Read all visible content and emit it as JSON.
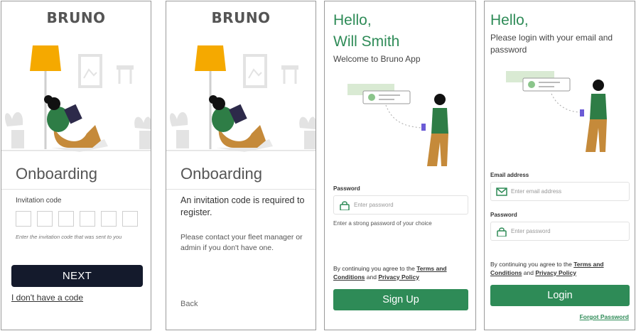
{
  "colors": {
    "brand_green": "#2e8b57",
    "dark_button": "#141a2c",
    "border": "#9a9a9a"
  },
  "screen1": {
    "brand": "BRUNO",
    "heading": "Onboarding",
    "invitation_label": "Invitation code",
    "code_boxes": 6,
    "hint": "Enter the invitation code that was sent to you",
    "next_button": "NEXT",
    "no_code_link": "I don't have a code"
  },
  "screen2": {
    "brand": "BRUNO",
    "heading": "Onboarding",
    "required_text": "An invitation code is required to register.",
    "contact_text": "Please contact your fleet manager or admin if you don't have one.",
    "back_link": "Back"
  },
  "screen3": {
    "hello": "Hello,",
    "name": "Will Smith",
    "welcome": "Welcome to Bruno App",
    "password_label": "Password",
    "password_placeholder": "Enter password",
    "password_help": "Enter a strong password of your choice",
    "terms_prefix": "By continuing you agree to the",
    "terms_link": "Terms and Conditions",
    "terms_and": "and",
    "privacy_link": "Privacy Policy",
    "signup_button": "Sign Up"
  },
  "screen4": {
    "hello": "Hello,",
    "subtitle": "Please login with your email and password",
    "email_label": "Email address",
    "email_placeholder": "Enter email address",
    "password_label": "Password",
    "password_placeholder": "Enter password",
    "terms_prefix": "By continuing you agree to the",
    "terms_link": "Terms and Conditions",
    "terms_and": "and",
    "privacy_link": "Privacy Policy",
    "login_button": "Login",
    "forgot_link": "Forgot Password"
  },
  "icons": {
    "lock": "lock-icon",
    "mail": "mail-icon",
    "check": "check-icon"
  }
}
